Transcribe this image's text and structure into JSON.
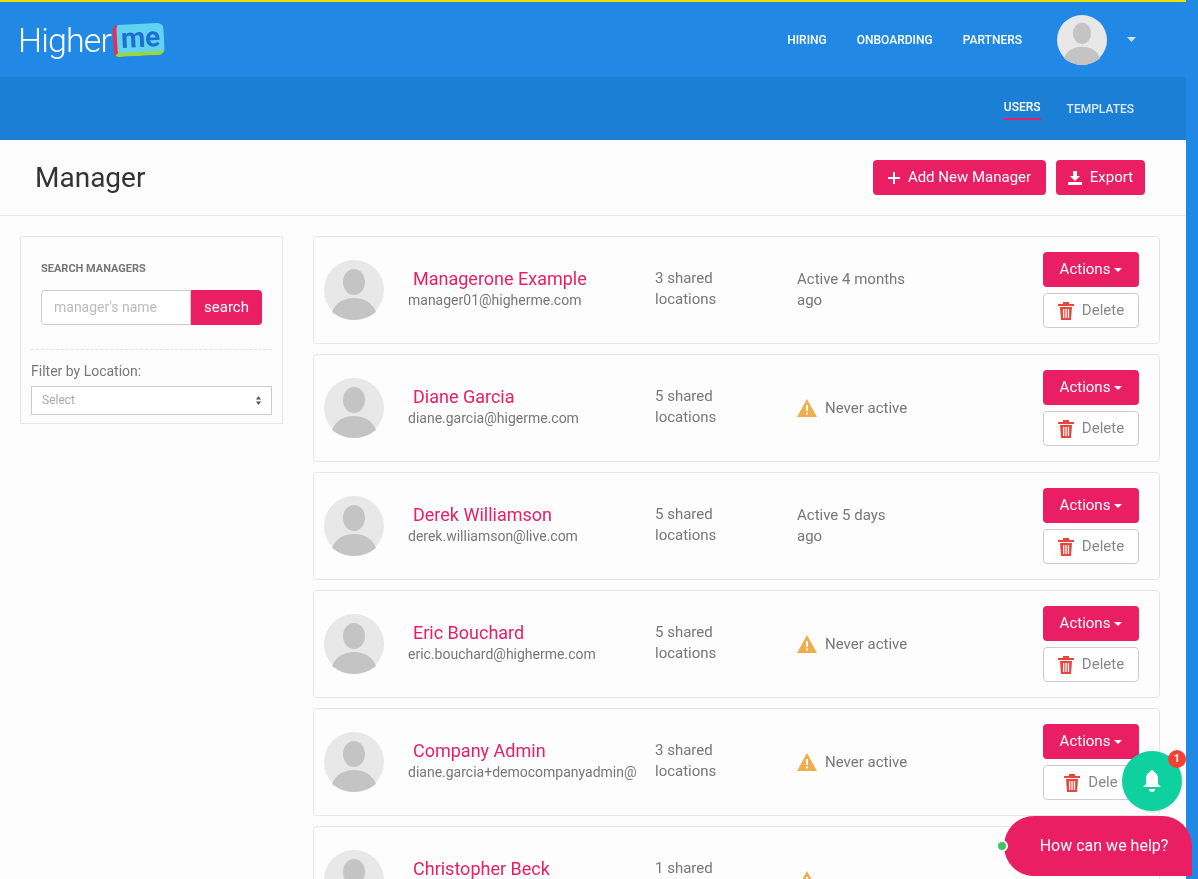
{
  "logo": {
    "text": "Higher",
    "mark": "me"
  },
  "nav": [
    {
      "label": "HIRING"
    },
    {
      "label": "ONBOARDING"
    },
    {
      "label": "PARTNERS"
    }
  ],
  "subnav": [
    {
      "label": "USERS",
      "selected": true
    },
    {
      "label": "TEMPLATES",
      "selected": false
    }
  ],
  "page_title": "Manager",
  "header_buttons": [
    {
      "kind": "add",
      "label": "Add New Manager"
    },
    {
      "kind": "export",
      "label": "Export"
    }
  ],
  "sidebar": {
    "heading": "SEARCH MANAGERS",
    "search": {
      "placeholder": "manager's name",
      "button": "search"
    },
    "filter_label": "Filter by Location:",
    "filter_select": {
      "placeholder": "Select"
    }
  },
  "managers": [
    {
      "name": "Managerone Example",
      "email": "manager01@higherme.com",
      "locations": "3 shared locations",
      "status": {
        "kind": "active",
        "text": "Active 4 months ago"
      },
      "actions": "Actions",
      "delete": "Delete"
    },
    {
      "name": "Diane Garcia",
      "email": "diane.garcia@higerme.com",
      "locations": "5 shared locations",
      "status": {
        "kind": "never",
        "text": "Never active"
      },
      "actions": "Actions",
      "delete": "Delete"
    },
    {
      "name": "Derek Williamson",
      "email": "derek.williamson@live.com",
      "locations": "5 shared locations",
      "status": {
        "kind": "active",
        "text": "Active 5 days ago"
      },
      "actions": "Actions",
      "delete": "Delete"
    },
    {
      "name": "Eric Bouchard",
      "email": "eric.bouchard@higherme.com",
      "locations": "5 shared locations",
      "status": {
        "kind": "never",
        "text": "Never active"
      },
      "actions": "Actions",
      "delete": "Delete"
    },
    {
      "name": "Company Admin",
      "email": "diane.garcia+democompanyadmin@",
      "locations": "3 shared locations",
      "status": {
        "kind": "never",
        "text": "Never active"
      },
      "actions": "Actions",
      "delete": "Dele"
    },
    {
      "name": "Christopher Beck",
      "locations": "1 shared",
      "status": {
        "kind": "never"
      }
    }
  ],
  "notifications": {
    "count": "1"
  },
  "chat": {
    "label": "How can we help?"
  }
}
